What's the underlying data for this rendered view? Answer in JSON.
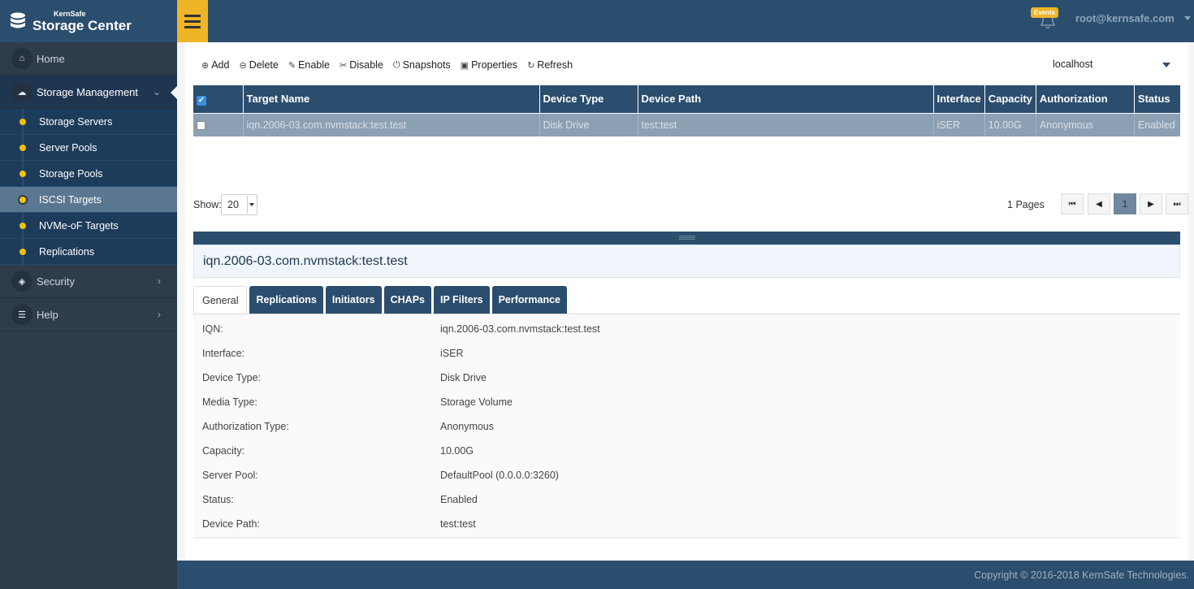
{
  "brand": {
    "small": "KernSafe",
    "big": "Storage Center"
  },
  "header": {
    "events_badge": "Events",
    "user": "root@kernsafe.com"
  },
  "sidebar": {
    "home": "Home",
    "storage_management": "Storage Management",
    "sub_items": [
      "Storage Servers",
      "Server Pools",
      "Storage Pools",
      "ISCSI Targets",
      "NVMe-oF Targets",
      "Replications"
    ],
    "active_sub": "ISCSI Targets",
    "security": "Security",
    "help": "Help"
  },
  "toolbar": {
    "add": "Add",
    "delete": "Delete",
    "enable": "Enable",
    "disable": "Disable",
    "snapshots": "Snapshots",
    "properties": "Properties",
    "refresh": "Refresh",
    "host": "localhost"
  },
  "table": {
    "headers": [
      "Target Name",
      "Device Type",
      "Device Path",
      "Interface",
      "Capacity",
      "Authorization",
      "Status"
    ],
    "rows": [
      [
        "iqn.2006-03.com.nvmstack:test.test",
        "Disk Drive",
        "test:test",
        "iSER",
        "10.00G",
        "Anonymous",
        "Enabled"
      ]
    ]
  },
  "pagination": {
    "show_label": "Show:",
    "page_size": "20",
    "pages_count": "1",
    "pages_label": "Pages",
    "current_page": "1"
  },
  "detail": {
    "title": "iqn.2006-03.com.nvmstack:test.test",
    "tabs": [
      "General",
      "Replications",
      "Initiators",
      "CHAPs",
      "IP Filters",
      "Performance"
    ],
    "active_tab": "General",
    "properties": [
      {
        "key": "IQN:",
        "value": "iqn.2006-03.com.nvmstack:test.test"
      },
      {
        "key": "Interface:",
        "value": "iSER"
      },
      {
        "key": "Device Type:",
        "value": "Disk Drive"
      },
      {
        "key": "Media Type:",
        "value": "Storage Volume"
      },
      {
        "key": "Authorization Type:",
        "value": "Anonymous"
      },
      {
        "key": "Capacity:",
        "value": "10.00G"
      },
      {
        "key": "Server Pool:",
        "value": "DefaultPool (0.0.0.0:3260)"
      },
      {
        "key": "Status:",
        "value": "Enabled"
      },
      {
        "key": "Device Path:",
        "value": "test:test"
      }
    ]
  },
  "footer": {
    "copyright": "Copyright © 2016-2018 KernSafe Technologies."
  },
  "colors": {
    "navy": "#2b4d6e",
    "accent": "#f0b429",
    "dot": "#f2c200"
  },
  "icons": [
    "hamburger-menu-icon",
    "bell-icon",
    "home-icon",
    "cloud-icon",
    "box-icon",
    "list-icon",
    "plus-circle-icon",
    "minus-circle-icon",
    "tag-icon",
    "scissors-icon",
    "power-icon",
    "play-square-icon",
    "refresh-icon"
  ]
}
